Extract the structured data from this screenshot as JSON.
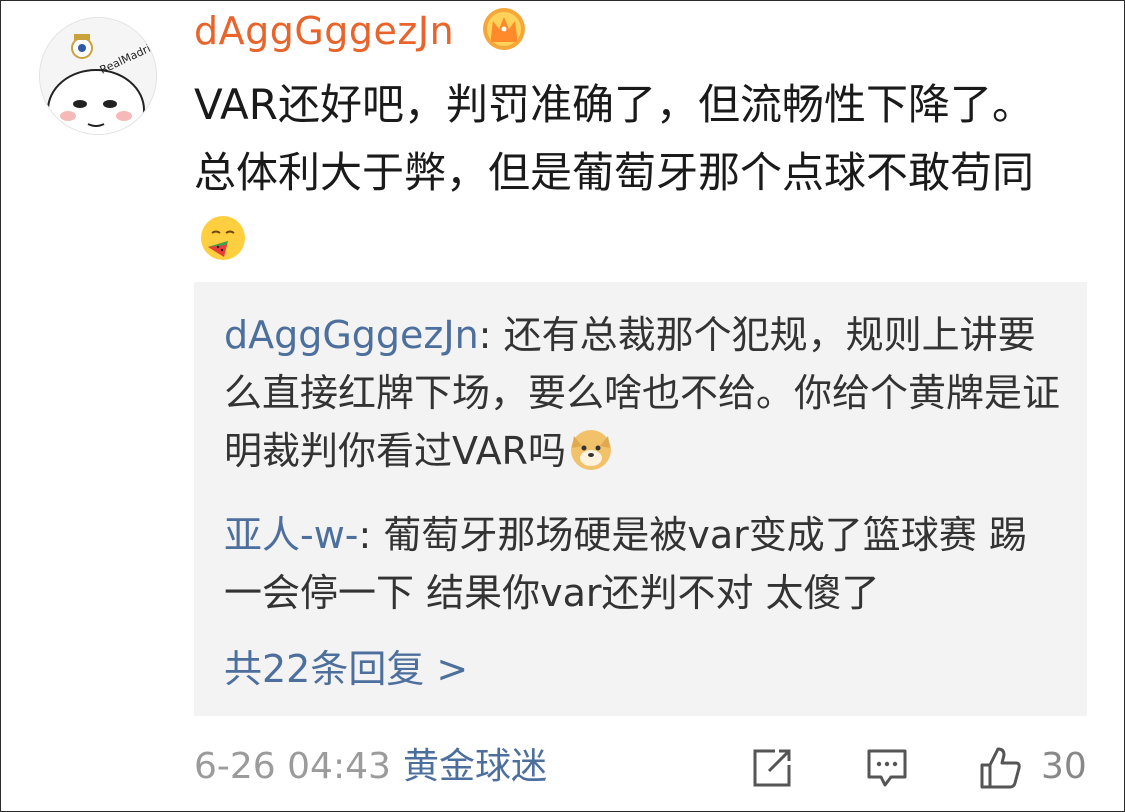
{
  "comment": {
    "username": "dAggGggezJn",
    "badge_icon": "crown-icon",
    "avatar_label": "RealMadrid",
    "text": "VAR还好吧，判罚准确了，但流畅性下降了。总体利大于弊，但是葡萄牙那个点球不敢苟同",
    "text_emoji": "thinking-eating-emoji"
  },
  "replies": {
    "items": [
      {
        "author": "dAggGggezJn",
        "separator": ": ",
        "text": "还有总裁那个犯规，规则上讲要么直接红牌下场，要么啥也不给。你给个黄牌是证明裁判你看过VAR吗",
        "emoji": "doge-emoji"
      },
      {
        "author": "亚人-w-",
        "separator": ": ",
        "text": "葡萄牙那场硬是被var变成了篮球赛 踢一会停一下 结果你var还判不对 太傻了"
      }
    ],
    "more_label": "共22条回复 >"
  },
  "footer": {
    "timestamp": "6-26 04:43",
    "source": "黄金球迷",
    "like_count": "30"
  },
  "colors": {
    "username": "#e8642a",
    "link": "#4d6f9d",
    "reply_bg": "#f3f3f3",
    "muted": "#9b9b9b"
  }
}
